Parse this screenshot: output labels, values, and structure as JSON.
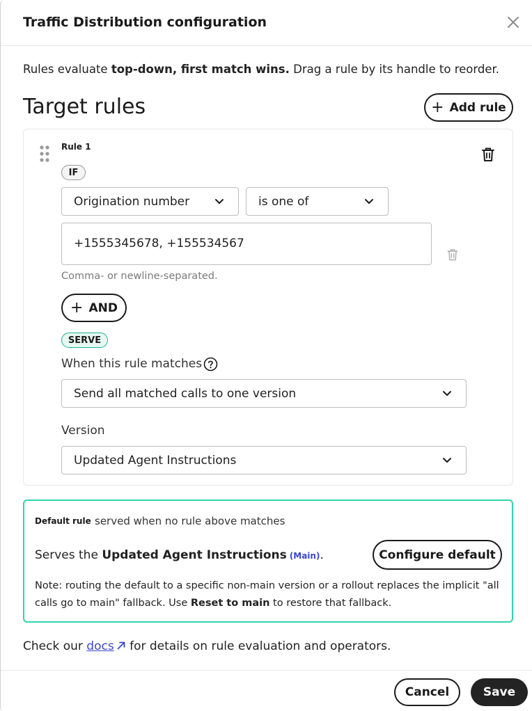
{
  "dialog": {
    "title": "Traffic Distribution configuration",
    "intro_prefix": "Rules evaluate ",
    "intro_bold": "top-down, first match wins.",
    "intro_suffix": " Drag a rule by its handle to reorder."
  },
  "target_rules": {
    "title": "Target rules",
    "add_rule_label": "Add rule"
  },
  "rule": {
    "label": "Rule 1",
    "if_tag": "IF",
    "field_select": "Origination number",
    "operator_select": "is one of",
    "values_text": "+1555345678, +155534567",
    "values_hint": "Comma- or newline-separated.",
    "and_label": "AND",
    "serve_tag": "SERVE",
    "when_label": "When this rule matches",
    "mode_select": "Send all matched calls to one version",
    "version_label": "Version",
    "version_select": "Updated Agent Instructions"
  },
  "default_rule": {
    "label": "Default rule",
    "description": "served when no rule above matches",
    "serves_prefix": "Serves the ",
    "serves_version": "Updated Agent Instructions",
    "serves_tag": "(Main)",
    "serves_suffix": ".",
    "configure_label": "Configure default",
    "note_prefix": "Note: routing the default to a specific non-main version or a rollout replaces the implicit \"all calls go to main\" fallback. Use ",
    "note_bold": "Reset to main",
    "note_suffix": " to restore that fallback."
  },
  "footer": {
    "text_prefix": "Check our ",
    "docs_link": "docs",
    "text_suffix": " for details on rule evaluation and operators.",
    "cancel_label": "Cancel",
    "save_label": "Save"
  },
  "colors": {
    "accent_teal": "#2fd4ad",
    "link_blue": "#3a45d6",
    "primary_dark": "#232323"
  }
}
